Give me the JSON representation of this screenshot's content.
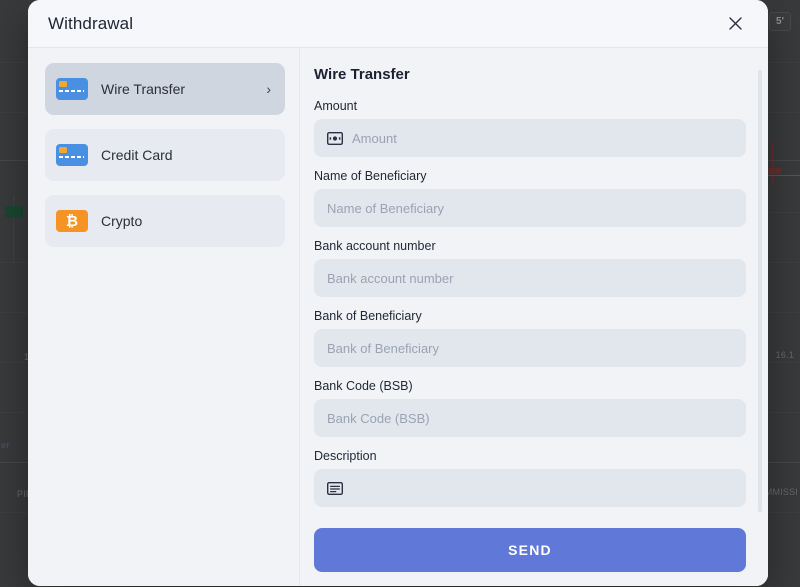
{
  "background": {
    "timeframe_pill": "5'",
    "price_label": "16.1",
    "commission_label": "OMMISSI",
    "partial_label": "er",
    "pip_label": "PIP",
    "chart_bg_color": "#4a4a4a",
    "bull_candle_color": "#1e5b3a"
  },
  "modal": {
    "title": "Withdrawal",
    "close_icon": "close-icon"
  },
  "methods": {
    "items": [
      {
        "id": "wire-transfer",
        "label": "Wire Transfer",
        "icon": "credit-card-icon",
        "selected": true,
        "chevron": "›"
      },
      {
        "id": "credit-card",
        "label": "Credit Card",
        "icon": "credit-card-icon",
        "selected": false,
        "chevron": ""
      },
      {
        "id": "crypto",
        "label": "Crypto",
        "icon": "bitcoin-icon",
        "selected": false,
        "chevron": ""
      }
    ]
  },
  "form": {
    "heading": "Wire Transfer",
    "fields": [
      {
        "id": "amount",
        "label": "Amount",
        "placeholder": "Amount",
        "value": "",
        "icon": "banknote-icon"
      },
      {
        "id": "name-of-beneficiary",
        "label": "Name of Beneficiary",
        "placeholder": "Name of Beneficiary",
        "value": "",
        "icon": ""
      },
      {
        "id": "bank-account-number",
        "label": "Bank account number",
        "placeholder": "Bank account number",
        "value": "",
        "icon": ""
      },
      {
        "id": "bank-of-beneficiary",
        "label": "Bank of Beneficiary",
        "placeholder": "Bank of Beneficiary",
        "value": "",
        "icon": ""
      },
      {
        "id": "bank-code-bsb",
        "label": "Bank Code (BSB)",
        "placeholder": "Bank Code (BSB)",
        "value": "",
        "icon": ""
      },
      {
        "id": "description",
        "label": "Description",
        "placeholder": "",
        "value": "",
        "icon": "note-icon"
      }
    ]
  },
  "footer": {
    "send_label": "SEND",
    "send_color": "#6078d8"
  }
}
